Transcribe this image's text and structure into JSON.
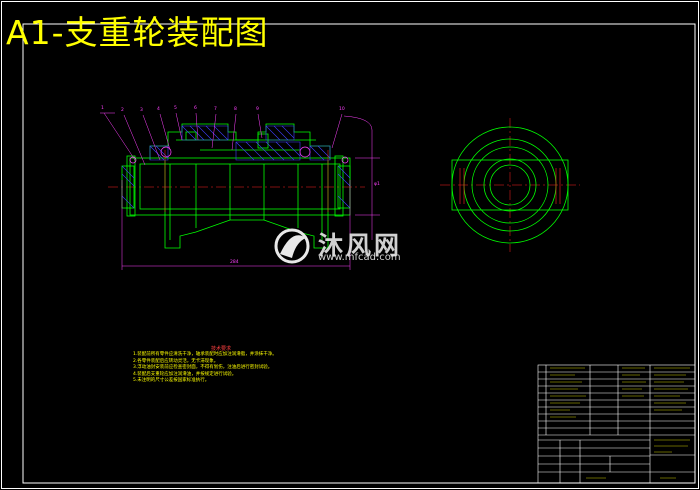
{
  "drawing": {
    "title": "A1-支重轮装配图",
    "watermark_brand": "沐风网",
    "watermark_url": "www.mfcad.com",
    "dim_length": "284",
    "dim_height": "φ1",
    "balloons": [
      "1",
      "2",
      "3",
      "4",
      "5",
      "6",
      "7",
      "8",
      "9",
      "10"
    ],
    "notes_title": "技术要求",
    "notes": [
      "1.装配前所有零件应清洗干净，轴承装配时应加注润滑脂，并涂抹干净。",
      "2.各零件装配后应转动灵活，无卡滞现象。",
      "3.浮动油封安装前应检查密封面，不得有划伤，注油后进行密封试验。",
      "4.装配后支重轮应加注润滑油，并按规定进行试验。",
      "5.未注明的尺寸公差按国家标准执行。"
    ]
  },
  "colors": {
    "frame": "#ffffff",
    "outline": "#00ff00",
    "center": "#ff2020",
    "dimension": "#ff40ff",
    "hatch": "#4040ff",
    "title": "#ffff00"
  },
  "icons": [
    "watermark-logo-icon"
  ]
}
